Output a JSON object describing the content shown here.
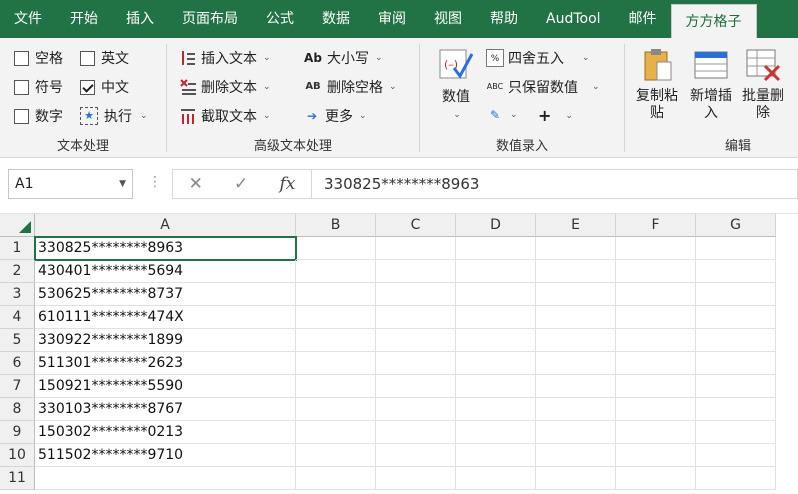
{
  "ribbon_tabs": [
    "文件",
    "开始",
    "插入",
    "页面布局",
    "公式",
    "数据",
    "审阅",
    "视图",
    "帮助",
    "AudTool",
    "邮件",
    "方方格子"
  ],
  "active_tab": "方方格子",
  "text_group": {
    "label": "文本处理",
    "checks": [
      {
        "label": "空格",
        "checked": false
      },
      {
        "label": "英文",
        "checked": false
      },
      {
        "label": "符号",
        "checked": false
      },
      {
        "label": "中文",
        "checked": true
      },
      {
        "label": "数字",
        "checked": false
      }
    ],
    "execute_label": "执行"
  },
  "adv_group": {
    "label": "高级文本处理",
    "insert_text": "插入文本",
    "delete_text": "删除文本",
    "cut_text": "截取文本",
    "case_label": "大小写",
    "case_icon_text": "Ab",
    "del_space": "删除空格",
    "del_space_icon_text": "AB",
    "more": "更多"
  },
  "num_group": {
    "label": "数值录入",
    "value_btn": "数值",
    "round": "四舍五入",
    "keep_value": "只保留数值",
    "keep_value_icon_text": "ABC",
    "plus": "+"
  },
  "edit_group": {
    "label": "编辑",
    "copy_paste": "复制粘\n贴",
    "new_insert": "新增插\n入",
    "batch_delete": "批量删\n除"
  },
  "formula_bar": {
    "name_box": "A1",
    "formula": "330825********8963",
    "fx": "fx"
  },
  "columns": [
    "A",
    "B",
    "C",
    "D",
    "E",
    "F",
    "G"
  ],
  "rows": [
    "1",
    "2",
    "3",
    "4",
    "5",
    "6",
    "7",
    "8",
    "9",
    "10",
    "11"
  ],
  "cells_a": [
    "330825********8963",
    "430401********5694",
    "530625********8737",
    "610111********474X",
    "330922********1899",
    "511301********2623",
    "150921********5590",
    "330103********8767",
    "150302********0213",
    "511502********9710",
    ""
  ],
  "accent_color": "#217346"
}
